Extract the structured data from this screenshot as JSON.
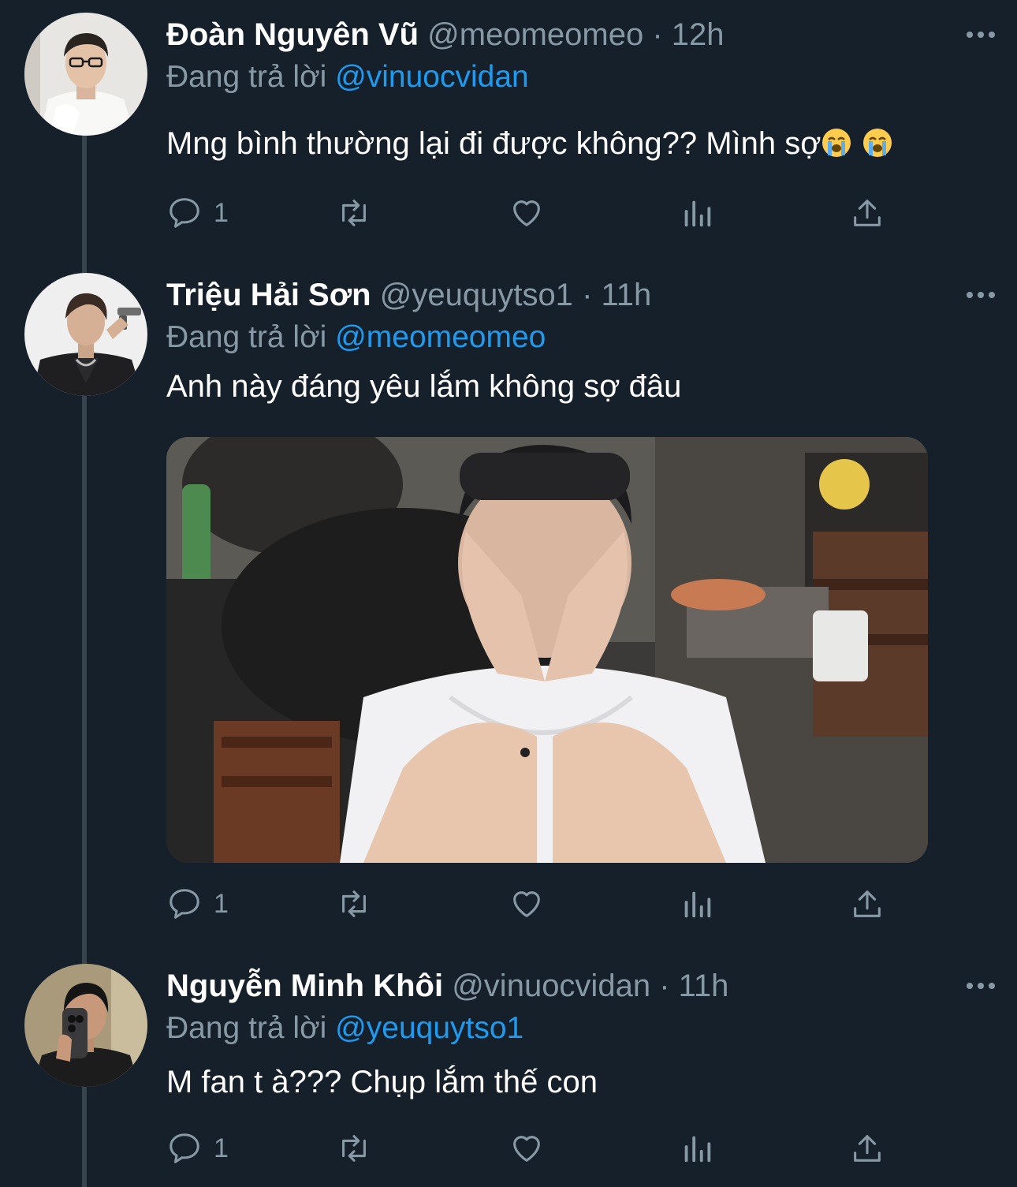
{
  "theme": {
    "background": "#15202b",
    "thread_line": "#38444d",
    "secondary_text": "#8899a6",
    "accent": "#1d9bf0"
  },
  "tweets": [
    {
      "display_name": "Đoàn Nguyên Vũ",
      "handle": "@meomeomeo",
      "separator": "·",
      "time": "12h",
      "reply_prefix": "Đang trả lời",
      "reply_to": "@vinuocvidan",
      "text": "Mng bình thường lại đi được không?? Mình sợ",
      "emoji": [
        "loudly-crying-face",
        "loudly-crying-face"
      ],
      "reply_count": "1",
      "has_media": false
    },
    {
      "display_name": "Triệu Hải Sơn",
      "handle": "@yeuquytso1",
      "separator": "·",
      "time": "11h",
      "reply_prefix": "Đang trả lời",
      "reply_to": "@meomeomeo",
      "text": "Anh này đáng yêu lắm không sợ đâu",
      "reply_count": "1",
      "has_media": true
    },
    {
      "display_name": "Nguyễn Minh Khôi",
      "handle": "@vinuocvidan",
      "separator": "·",
      "time": "11h",
      "reply_prefix": "Đang trả lời",
      "reply_to": "@yeuquytso1",
      "text": "M fan t à??? Chụp lắm thế con",
      "reply_count": "1",
      "has_media": false
    }
  ],
  "action_icons": [
    "reply-icon",
    "retweet-icon",
    "like-icon",
    "analytics-icon",
    "share-icon"
  ]
}
